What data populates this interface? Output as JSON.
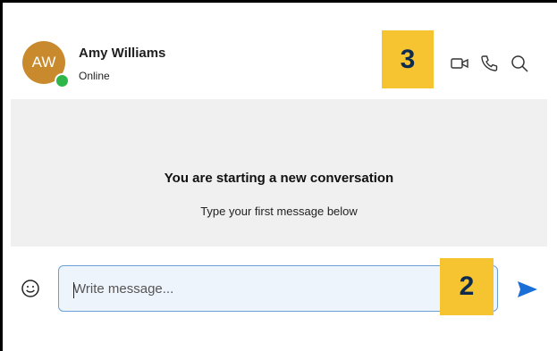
{
  "contact": {
    "initials": "AW",
    "name": "Amy Williams",
    "status": "Online",
    "avatar_color": "#c98a2e",
    "presence_color": "#2fb64a"
  },
  "header_actions": {
    "icons": [
      "video-call-icon",
      "phone-call-icon",
      "search-icon"
    ]
  },
  "callouts": {
    "header_badge": "3",
    "composer_badge": "2",
    "badge_color": "#f5c430"
  },
  "conversation": {
    "empty_title": "You are starting a new conversation",
    "empty_subtitle": "Type your first message below"
  },
  "composer": {
    "placeholder": "Write message...",
    "value": "",
    "emoji_icon": "smiley-icon",
    "send_icon": "send-arrow-icon",
    "send_color": "#1a6fd6"
  }
}
